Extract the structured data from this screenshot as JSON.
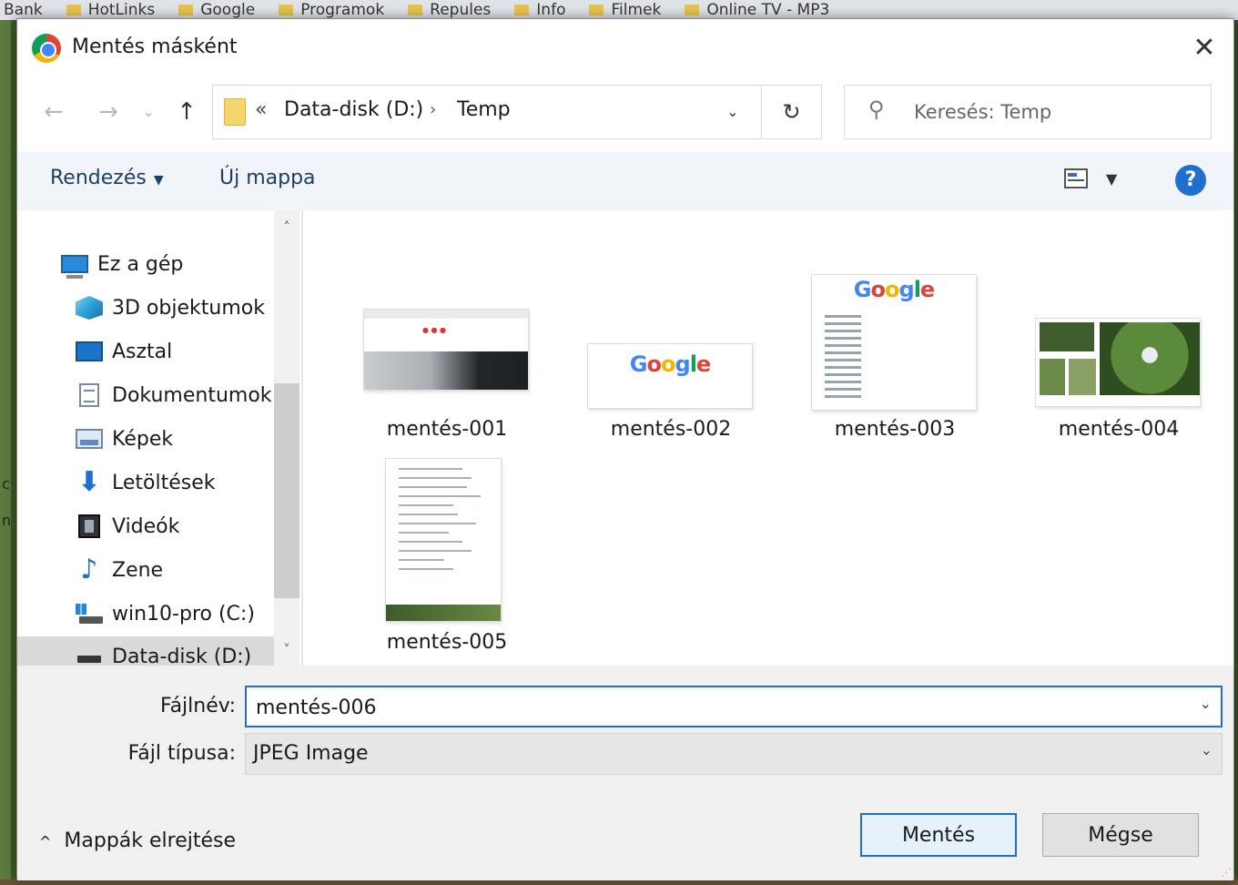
{
  "background": {
    "bookmarks": [
      "Bank",
      "HotLinks",
      "Google",
      "Programok",
      "Repules",
      "Info",
      "Filmek",
      "Online TV - MP3"
    ],
    "side_fragments": [
      "c",
      "n"
    ]
  },
  "dialog": {
    "title": "Mentés másként",
    "close_glyph": "✕"
  },
  "nav": {
    "back": "←",
    "forward": "→",
    "recent": "⌄",
    "up": "↑",
    "breadcrumb_prefix": "«",
    "breadcrumb": [
      "Data-disk (D:)",
      "Temp"
    ],
    "breadcrumb_sep": "›",
    "dropdown": "⌄",
    "refresh": "↻",
    "search_placeholder": "Keresés: Temp",
    "search_icon": "⚲"
  },
  "toolbar": {
    "organize_label": "Rendezés",
    "organize_caret": "▼",
    "new_folder_label": "Új mappa",
    "view_caret": "▼",
    "help_label": "?"
  },
  "sidebar": {
    "items": [
      {
        "label": "Ez a gép",
        "icon": "computer-icon"
      },
      {
        "label": "3D objektumok",
        "icon": "3d-objects-icon"
      },
      {
        "label": "Asztal",
        "icon": "desktop-icon"
      },
      {
        "label": "Dokumentumok",
        "icon": "documents-icon"
      },
      {
        "label": "Képek",
        "icon": "pictures-icon"
      },
      {
        "label": "Letöltések",
        "icon": "downloads-icon"
      },
      {
        "label": "Videók",
        "icon": "videos-icon"
      },
      {
        "label": "Zene",
        "icon": "music-icon"
      },
      {
        "label": "win10-pro (C:)",
        "icon": "windows-drive-icon"
      },
      {
        "label": "Data-disk (D:)",
        "icon": "drive-icon"
      }
    ],
    "selected": "Data-disk (D:)",
    "scroll_up": "˄",
    "scroll_down": "˅",
    "download_glyph": "⬇",
    "music_glyph": "♪"
  },
  "files": [
    {
      "name": "mentés-001"
    },
    {
      "name": "mentés-002"
    },
    {
      "name": "mentés-003"
    },
    {
      "name": "mentés-004"
    },
    {
      "name": "mentés-005"
    }
  ],
  "thumbnail_text": {
    "google_letters": [
      "G",
      "o",
      "o",
      "g",
      "l",
      "e"
    ]
  },
  "form": {
    "filename_label": "Fájlnév:",
    "filename_value": "mentés-006",
    "filetype_label": "Fájl típusa:",
    "filetype_value": "JPEG Image",
    "dropdown_chevron": "⌄"
  },
  "footer": {
    "hide_folders_caret": "^",
    "hide_folders_label": "Mappák elrejtése",
    "save_label": "Mentés",
    "cancel_label": "Mégse",
    "resize_grip": "⋰"
  },
  "colors": {
    "accent": "#1f6fd1",
    "folder": "#f6d56a",
    "command_bar": "#f1f4f9",
    "link_text": "#1e3f66"
  }
}
